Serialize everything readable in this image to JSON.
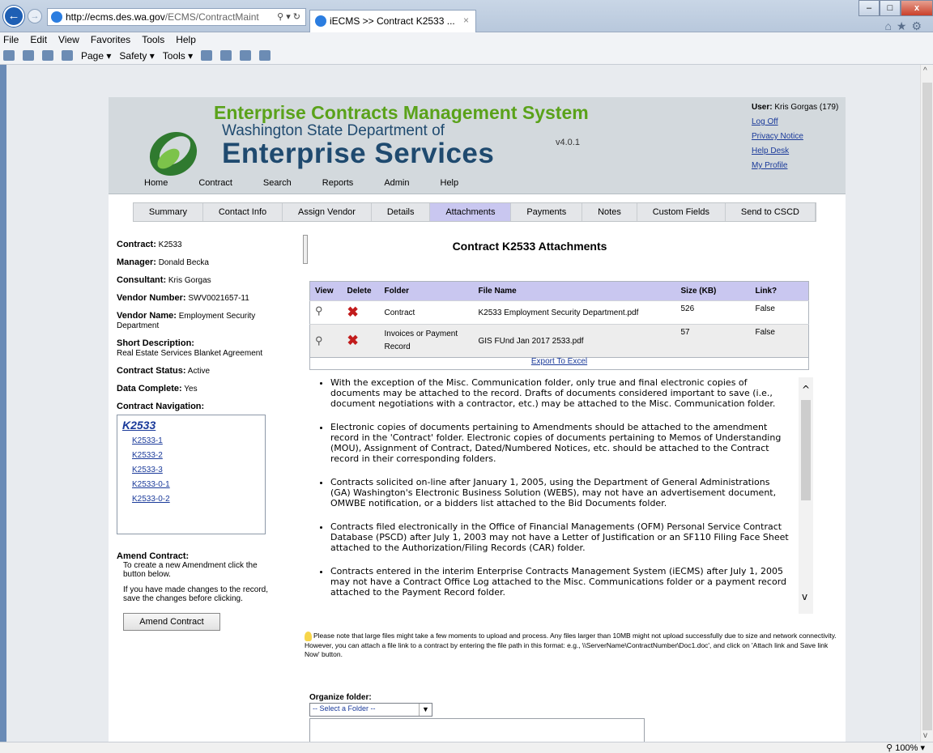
{
  "browser": {
    "address_domain": "http://ecms.des.wa.gov",
    "address_rest": "/ECMS/ContractMaint",
    "tab_title": "iECMS >> Contract K2533 ...",
    "menu": [
      "File",
      "Edit",
      "View",
      "Favorites",
      "Tools",
      "Help"
    ],
    "command_bar": [
      "Page ▾",
      "Safety ▾",
      "Tools ▾"
    ],
    "zoom": "100%"
  },
  "header": {
    "title": "Enterprise Contracts Management System",
    "org_line1": "Washington State Department of",
    "org_line2": "Enterprise Services",
    "version": "v4.0.1",
    "user_label": "User:",
    "user_name": "Kris Gorgas (179)",
    "links": [
      "Log Off",
      "Privacy Notice",
      "Help Desk",
      "My Profile"
    ],
    "nav": [
      "Home",
      "Contract",
      "Search",
      "Reports",
      "Admin",
      "Help"
    ]
  },
  "tabs": [
    "Summary",
    "Contact Info",
    "Assign Vendor",
    "Details",
    "Attachments",
    "Payments",
    "Notes",
    "Custom Fields",
    "Send to CSCD"
  ],
  "active_tab": "Attachments",
  "left": {
    "contract_label": "Contract:",
    "contract": "K2533",
    "manager_label": "Manager:",
    "manager": "Donald Becka",
    "consultant_label": "Consultant:",
    "consultant": "Kris Gorgas",
    "vendor_number_label": "Vendor Number:",
    "vendor_number": "SWV0021657-11",
    "vendor_name_label": "Vendor Name:",
    "vendor_name": "Employment Security Department",
    "short_desc_label": "Short Description:",
    "short_desc": "Real Estate Services Blanket Agreement",
    "status_label": "Contract Status:",
    "status": "Active",
    "data_complete_label": "Data Complete:",
    "data_complete": "Yes",
    "nav_label": "Contract Navigation:",
    "nav_root": "K2533",
    "nav_items": [
      "K2533-1",
      "K2533-2",
      "K2533-3",
      "K2533-0-1",
      "K2533-0-2"
    ],
    "amend_heading": "Amend Contract:",
    "amend_text1": "To create a new Amendment click the button below.",
    "amend_text2": "If you have made changes to the record, save the changes before clicking.",
    "amend_button": "Amend Contract"
  },
  "content": {
    "title": "Contract K2533 Attachments",
    "table": {
      "headers": [
        "View",
        "Delete",
        "Folder",
        "File Name",
        "Size (KB)",
        "Link?"
      ],
      "rows": [
        {
          "folder": "Contract",
          "file": "K2533 Employment Security Department.pdf",
          "size": "526",
          "link": "False"
        },
        {
          "folder": "Invoices or Payment Record",
          "file": "GIS FUnd Jan 2017 2533.pdf",
          "size": "57",
          "link": "False"
        }
      ]
    },
    "export": "Export To Excel",
    "notes": [
      "With the exception of the Misc. Communication folder, only true and final electronic copies of documents may be attached to the record. Drafts of documents considered important to save (i.e., document negotiations with a contractor, etc.) may be attached to the Misc. Communication folder.",
      "Electronic copies of documents pertaining to Amendments should be attached to the amendment record in the 'Contract' folder. Electronic copies of documents pertaining to Memos of Understanding (MOU), Assignment of Contract, Dated/Numbered Notices, etc. should be attached to the Contract record in their corresponding folders.",
      "Contracts solicited on-line after January 1, 2005, using the Department of General Administrations (GA) Washington's Electronic Business Solution (WEBS), may not have an advertisement document, OMWBE notification, or a bidders list attached to the Bid Documents folder.",
      "Contracts filed electronically in the Office of Financial Managements (OFM) Personal Service Contract Database (PSCD) after July 1, 2003 may not have a Letter of Justification or an SF110 Filing Face Sheet attached to the Authorization/Filing Records (CAR) folder.",
      "Contracts entered in the interim Enterprise Contracts Management System (iECMS) after July 1, 2005 may not have a Contract Office Log attached to the Misc. Communications folder or a payment record attached to the Payment Record folder."
    ],
    "tip": "Please note that large files might take a few moments to upload and process. Any files larger than 10MB might not upload successfully due to size and network connectivity. However, you can attach a file link to a contract by entering the file path in this format: e.g., \\\\ServerName\\ContractNumber\\Doc1.doc', and click on 'Attach link and Save link Now' button.",
    "organize_label": "Organize folder:",
    "organize_value": "-- Select a Folder --"
  }
}
